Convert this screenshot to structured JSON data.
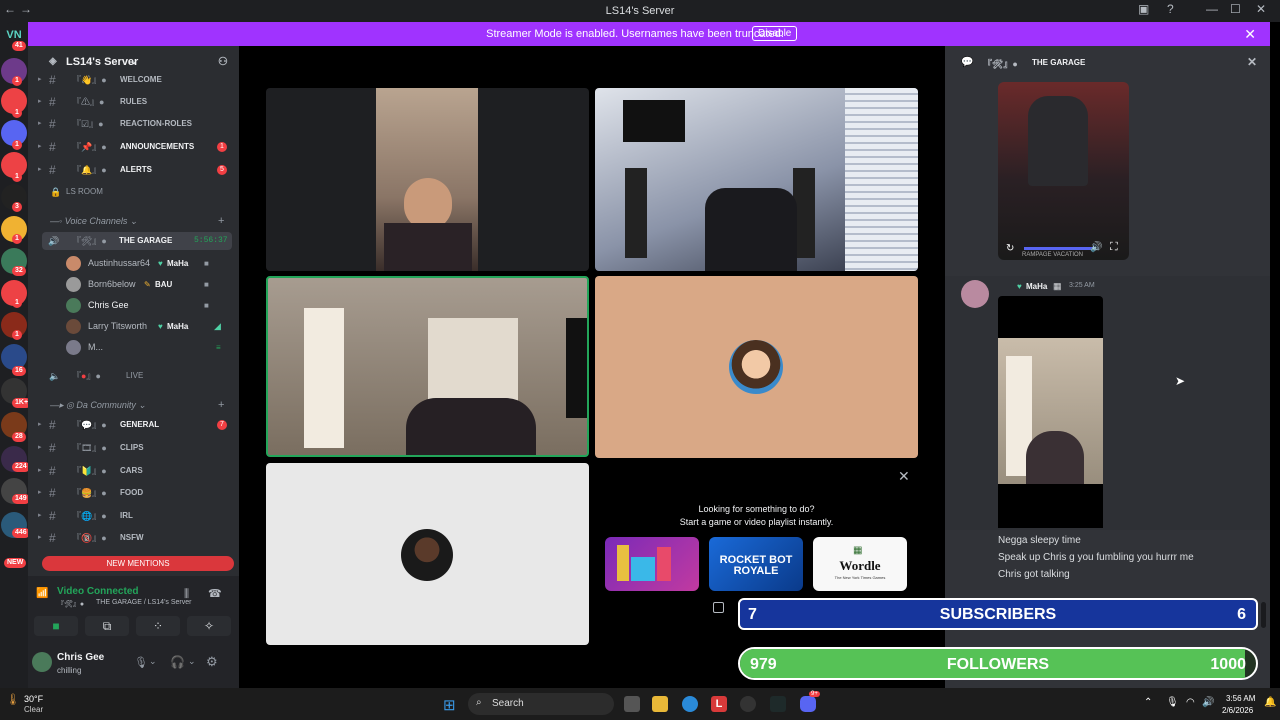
{
  "window": {
    "title": "LS14's Server"
  },
  "streamer_bar": {
    "message": "Streamer Mode is enabled. Usernames have been truncated.",
    "disable_label": "Disable"
  },
  "guilds": {
    "badges": [
      "41",
      "1",
      "1",
      "1",
      "1",
      "3",
      "1",
      "1",
      "32",
      "1",
      "1",
      "16",
      "1K+",
      "28",
      "224",
      "149",
      "446",
      "NEW"
    ]
  },
  "server": {
    "name": "LS14's Server"
  },
  "text_channels": [
    {
      "name": "WELCOME",
      "badge": ""
    },
    {
      "name": "RULES",
      "badge": ""
    },
    {
      "name": "REACTION-ROLES",
      "badge": ""
    },
    {
      "name": "ANNOUNCEMENTS",
      "badge": "1"
    },
    {
      "name": "ALERTS",
      "badge": "5"
    }
  ],
  "ls_room": "LS ROOM",
  "voice_category": "Voice Channels",
  "voice_channel": {
    "name": "THE GARAGE",
    "timer": "5:56:37"
  },
  "voice_users": [
    {
      "name": "Austinhussar64",
      "tag": "MaHa"
    },
    {
      "name": "Born6below",
      "tag": "BAU"
    },
    {
      "name": "Chris Gee",
      "tag": ""
    },
    {
      "name": "Larry Titsworth",
      "tag": "MaHa"
    },
    {
      "name": "M...",
      "tag": ""
    }
  ],
  "live_channel": {
    "name": "LIVE"
  },
  "community_category": "Da Community",
  "community_channels": [
    {
      "name": "GENERAL",
      "badge": "7"
    },
    {
      "name": "CLIPS",
      "badge": ""
    },
    {
      "name": "CARS",
      "badge": ""
    },
    {
      "name": "FOOD",
      "badge": ""
    },
    {
      "name": "IRL",
      "badge": ""
    },
    {
      "name": "NSFW",
      "badge": ""
    }
  ],
  "new_mentions": "NEW MENTIONS",
  "voice_panel": {
    "status": "Video Connected",
    "location": "THE GARAGE / LS14's Server"
  },
  "user": {
    "name": "Chris Gee",
    "status": "chilling"
  },
  "activity": {
    "line1": "Looking for something to do?",
    "line2": "Start a game or video playlist instantly.",
    "games": [
      "",
      "ROCKET BOT ROYALE",
      "Wordle"
    ],
    "wordle_sub": "The New York Times Games"
  },
  "chat": {
    "header": "THE GARAGE",
    "video_overlay": "RAMPAGE VACATION",
    "author_tag": "MaHa",
    "time": "3:25 AM",
    "messages": [
      "Negga sleepy time",
      "Speak up Chris g you fumbling you hurrr me",
      "Chris got talking"
    ]
  },
  "overlays": {
    "subscribers": {
      "current": "7",
      "label": "SUBSCRIBERS",
      "goal": "6"
    },
    "followers": {
      "current": "979",
      "label": "FOLLOWERS",
      "goal": "1000",
      "progress": 0.979
    }
  },
  "taskbar": {
    "weather_temp": "30°F",
    "weather_desc": "Clear",
    "search_label": "Search",
    "time": "3:56 AM",
    "date": "2/6/2026",
    "discord_badge": "9+"
  },
  "colors": {
    "streamer": "#a033ff",
    "connected": "#23a55a",
    "mention": "#da373c",
    "blurple": "#5865f2",
    "followers": "#56c256"
  }
}
